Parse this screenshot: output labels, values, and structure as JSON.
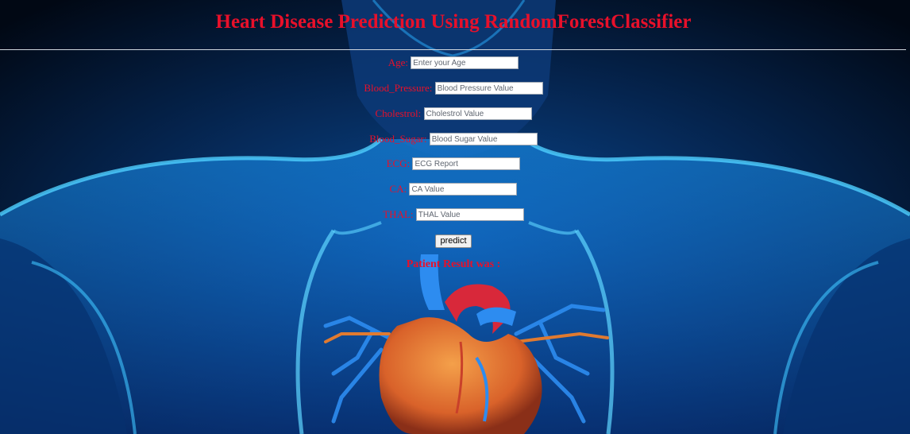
{
  "page": {
    "title": "Heart Disease Prediction Using RandomForestClassifier"
  },
  "form": {
    "fields": [
      {
        "label": "Age:",
        "placeholder": "Enter your Age"
      },
      {
        "label": "Blood_Pressure:",
        "placeholder": "Blood Pressure Value"
      },
      {
        "label": "Cholestrol:",
        "placeholder": "Cholestrol Value"
      },
      {
        "label": "Blood_Sugar:",
        "placeholder": "Blood Sugar Value"
      },
      {
        "label": "ECG:",
        "placeholder": "ECG Report"
      },
      {
        "label": "CA:",
        "placeholder": "CA Value"
      },
      {
        "label": "THAL:",
        "placeholder": "THAL Value"
      }
    ],
    "submit_label": "predict"
  },
  "result": {
    "text": "Patient Result was :"
  },
  "colors": {
    "accent": "#e8102a",
    "background": "#020c1e",
    "glow": "#1aa3ff"
  }
}
